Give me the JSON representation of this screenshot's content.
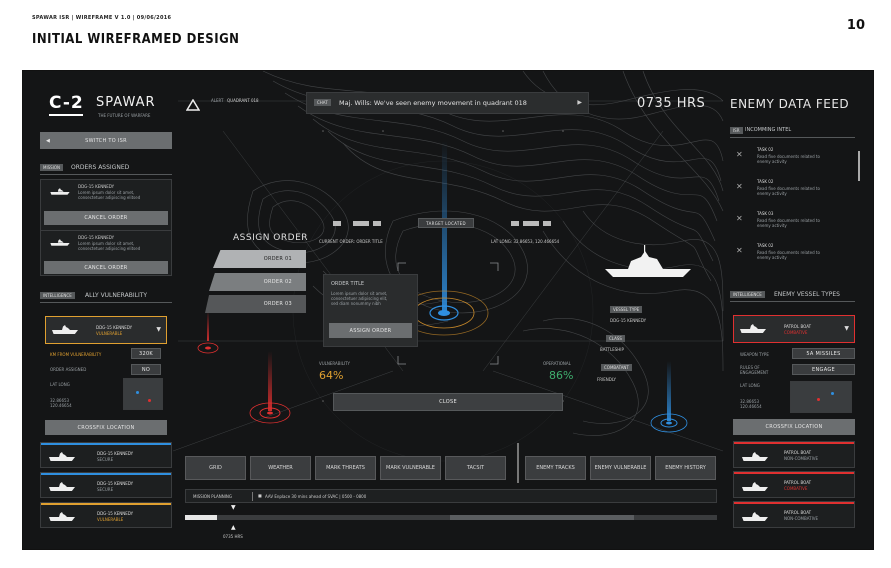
{
  "slide": {
    "meta": "SPAWAR ISR | WIREFRAME V 1.0 | 09/06/2016",
    "title": "INITIAL WIREFRAMED DESIGN",
    "page_number": "10"
  },
  "brand": {
    "logo": "C-2",
    "name": "SPAWAR",
    "tagline": "THE FUTURE OF WARFARE"
  },
  "header": {
    "alert_label": "ALERT",
    "quadrant": "QUADRANT 018",
    "message_tag": "CHAT",
    "message": "Maj. Wills: We've seen enemy movement in quadrant 018",
    "time": "0735 HRS"
  },
  "left": {
    "switch_button": "SWITCH TO ISR",
    "orders_tag": "MISSION",
    "orders_title": "ORDERS ASSIGNED",
    "orders": [
      {
        "name": "DDG-15 KENNEDY",
        "desc1": "Lorem ipsum dolor sit amet,",
        "desc2": "consectetuer adipiscing elitsed",
        "cancel": "CANCEL ORDER"
      },
      {
        "name": "DDG-15 KENNEDY",
        "desc1": "Lorem ipsum dolor sit amet,",
        "desc2": "consectetuer adipiscing elitsed",
        "cancel": "CANCEL ORDER"
      }
    ],
    "vuln_tag": "INTELLIGENCE",
    "vuln_title": "ALLY VULNERABILITY",
    "selected": {
      "name": "DDG-15 KENNEDY",
      "status": "VULNERABLE"
    },
    "km_label": "KM FROM VULNERABILITY",
    "km_value": "320K",
    "order_assigned_label": "ORDER ASSIGNED",
    "order_assigned_value": "NO",
    "latlong_label": "LAT LONG",
    "lat": "32.86653",
    "long": "120.46654",
    "crossfix": "CROSSFIX LOCATION",
    "allies": [
      {
        "name": "DDG-15 KENNEDY",
        "status": "SECURE",
        "color": "#2f8fe0"
      },
      {
        "name": "DDG-15 KENNEDY",
        "status": "SECURE",
        "color": "#2f8fe0"
      },
      {
        "name": "DDG-15 KENNEDY",
        "status": "VULNERABLE",
        "color": "#e0a030"
      }
    ]
  },
  "center": {
    "target_located": "TARGET LOCATED",
    "current_order": "CURRENT ORDER: ORDER TITLE",
    "lat_long": "LAT LONG: 32.86653, 120.466654",
    "assign_title": "ASSIGN ORDER",
    "orders": [
      "ORDER 01",
      "ORDER 02",
      "ORDER 03"
    ],
    "order_title": "ORDER TITLE",
    "order_desc1": "Lorem ipsum dolor sit amet,",
    "order_desc2": "consectetuer adipiscing elit,",
    "order_desc3": "sed diam nonummy nibh",
    "assign_button": "ASSIGN ORDER",
    "vulnerability_label": "VULNERABILITY",
    "vulnerability_value": "64%",
    "operational_label": "OPERATIONAL",
    "operational_value": "86%",
    "vessel_type_tag": "VESSEL TYPE",
    "vessel_name": "DDG-15 KENNEDY",
    "class_tag": "CLASS",
    "class_value": "BATTLESHIP",
    "combatant_tag": "COMBATANT",
    "combatant_value": "FRIENDLY",
    "close": "CLOSE"
  },
  "toolbar": {
    "buttons": [
      "GRID",
      "WEATHER",
      "MARK THREATS",
      "MARK VULNERABLE",
      "TACSIT",
      "ENEMY TRACKS",
      "ENEMY VULNERABLE",
      "ENEMY HISTORY"
    ],
    "planning_label": "MISSION PLANNING",
    "planning_text": "AAV Enplace 30 mins ahead of SVAC  |  0500 - 0800",
    "timeline_time": "0735 HRS"
  },
  "right": {
    "title": "ENEMY DATA FEED",
    "intel_tag": "ISR",
    "intel_title": "INCOMMING INTEL",
    "tasks": [
      {
        "title": "TASK 02",
        "desc1": "Read five documents related to",
        "desc2": "enemy activity"
      },
      {
        "title": "TASK 02",
        "desc1": "Read five documents related to",
        "desc2": "enemy activity"
      },
      {
        "title": "TASK 03",
        "desc1": "Read five documents related to",
        "desc2": "enemy activity"
      },
      {
        "title": "TASK 02",
        "desc1": "Read five documents related to",
        "desc2": "enemy activity"
      }
    ],
    "vessel_tag": "INTELLIGENCE",
    "vessel_title": "ENEMY VESSEL TYPES",
    "selected": {
      "name": "PATROL BOAT",
      "status": "COMBATIVE"
    },
    "weapon_label": "WEAPON TYPE",
    "weapon_value": "5A MISSILES",
    "rules_label1": "RULES OF",
    "rules_label2": "ENGAGEMENT",
    "rules_value": "ENGAGE",
    "latlong_label": "LAT LONG",
    "lat": "32.86653",
    "long": "120.46654",
    "crossfix": "CROSSFIX LOCATION",
    "enemies": [
      {
        "name": "PATROL BOAT",
        "status": "NON-COMBATIVE",
        "color": "#e03030"
      },
      {
        "name": "PATROL BOAT",
        "status": "COMBATIVE",
        "color": "#e03030"
      },
      {
        "name": "PATROL BOAT",
        "status": "NON-COMBATIVE",
        "color": "#e03030"
      }
    ]
  },
  "colors": {
    "accent_blue": "#2f8fe0",
    "accent_red": "#e03030",
    "accent_orange": "#e0a030",
    "accent_green": "#3fae6e"
  }
}
